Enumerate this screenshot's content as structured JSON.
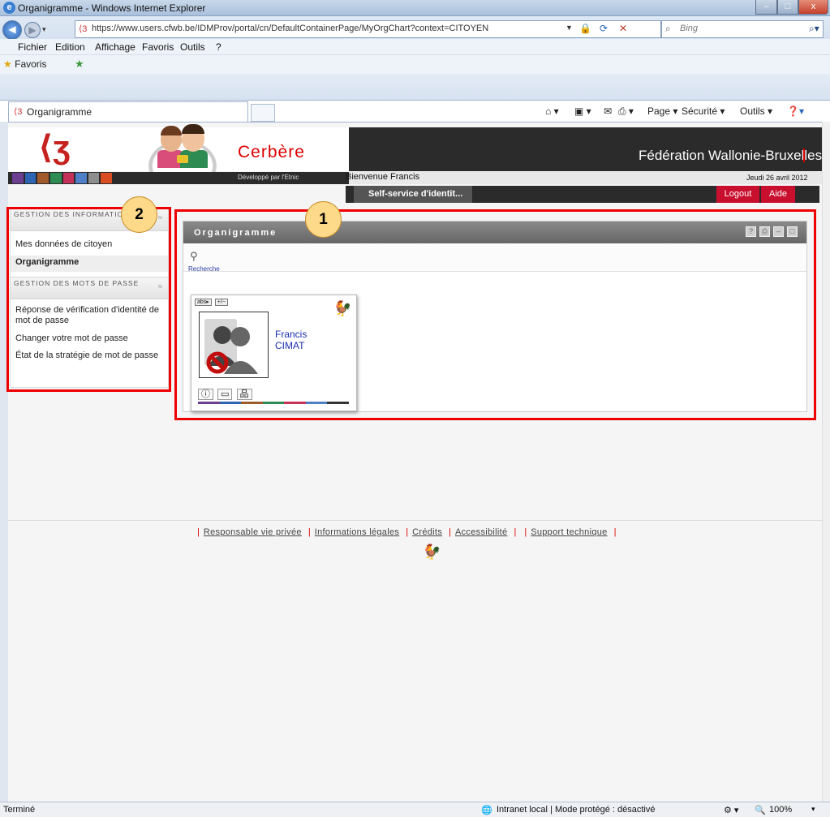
{
  "window": {
    "title": "Organigramme - Windows Internet Explorer",
    "minimize": "–",
    "maximize": "□",
    "close": "x"
  },
  "address": {
    "url": "https://www.users.cfwb.be/IDMProv/portal/cn/DefaultContainerPage/MyOrgChart?context=CITOYEN",
    "search_placeholder": "Bing"
  },
  "menu": {
    "items": [
      "Fichier",
      "Edition",
      "Affichage",
      "Favoris",
      "Outils",
      "?"
    ]
  },
  "favorites": {
    "label": "Favoris"
  },
  "tab": {
    "label": "Organigramme"
  },
  "commandbar": {
    "page": "Page ▾",
    "security": "Sécurité ▾",
    "tools": "Outils ▾"
  },
  "header": {
    "app_name": "Cerbère",
    "developer": "Développé par l'Etnic",
    "org": "Fédération Wallonie-Bruxelles",
    "welcome": "Bienvenue Francis",
    "date": "Jeudi 26 avril 2012",
    "selfservice": "Self-service d'identit...",
    "logout": "Logout",
    "help": "Aide"
  },
  "sidebar": {
    "section1": "GESTION DES INFORMATIONS",
    "items1": [
      "Mes données de citoyen",
      "Organigramme"
    ],
    "section2": "GESTION DES MOTS DE PASSE",
    "items2": [
      "Réponse de vérification d'identité de mot de passe",
      "Changer votre mot de passe",
      "État de la stratégie de mot de passe"
    ]
  },
  "portlet": {
    "title": "Organigramme",
    "search": "Recherche",
    "card": {
      "tag1": "abs▸",
      "tag2": "+/−",
      "first_name": "Francis",
      "last_name": "CIMAT"
    }
  },
  "footer": {
    "links": [
      "Responsable vie privée",
      "Informations légales",
      "Crédits",
      "Accessibilité",
      "Support technique"
    ]
  },
  "status": {
    "left": "Terminé",
    "zone": "Intranet local | Mode protégé : désactivé",
    "zoom": "100%"
  },
  "annotations": {
    "callout1": "1",
    "callout2": "2"
  },
  "colors": {
    "brand_red": "#c80f2e",
    "banner_dark": "#2b2b2b",
    "strip": [
      "#6b3e8f",
      "#2e64b4",
      "#a05a2c",
      "#2e8c52",
      "#c4325a",
      "#4f7fc7",
      "#8e8e8e",
      "#d94f23"
    ]
  }
}
